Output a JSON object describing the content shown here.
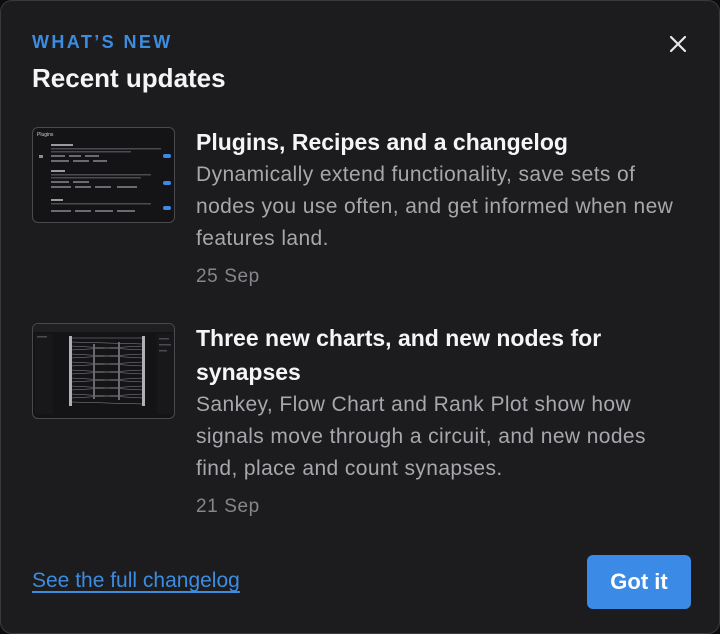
{
  "header": {
    "eyebrow": "WHAT’S NEW",
    "title": "Recent updates",
    "close_icon": "close-icon"
  },
  "updates": [
    {
      "title": "Plugins, Recipes and a changelog",
      "description": "Dynamically extend functionality, save sets of nodes you use often, and get informed when new features land.",
      "date": "25 Sep",
      "thumbnail": {
        "heading": "Plugins"
      }
    },
    {
      "title": "Three new charts, and new nodes for synapses",
      "description": "Sankey, Flow Chart and Rank Plot show how signals move through a circuit, and new nodes find, place and count synapses.",
      "date": "21 Sep"
    }
  ],
  "footer": {
    "link_label": "See the full changelog",
    "button_label": "Got it"
  },
  "colors": {
    "accent": "#3a8ae6",
    "background": "#1c1c1e",
    "text_primary": "#f5f5f7",
    "text_secondary": "#a7a7ac"
  }
}
